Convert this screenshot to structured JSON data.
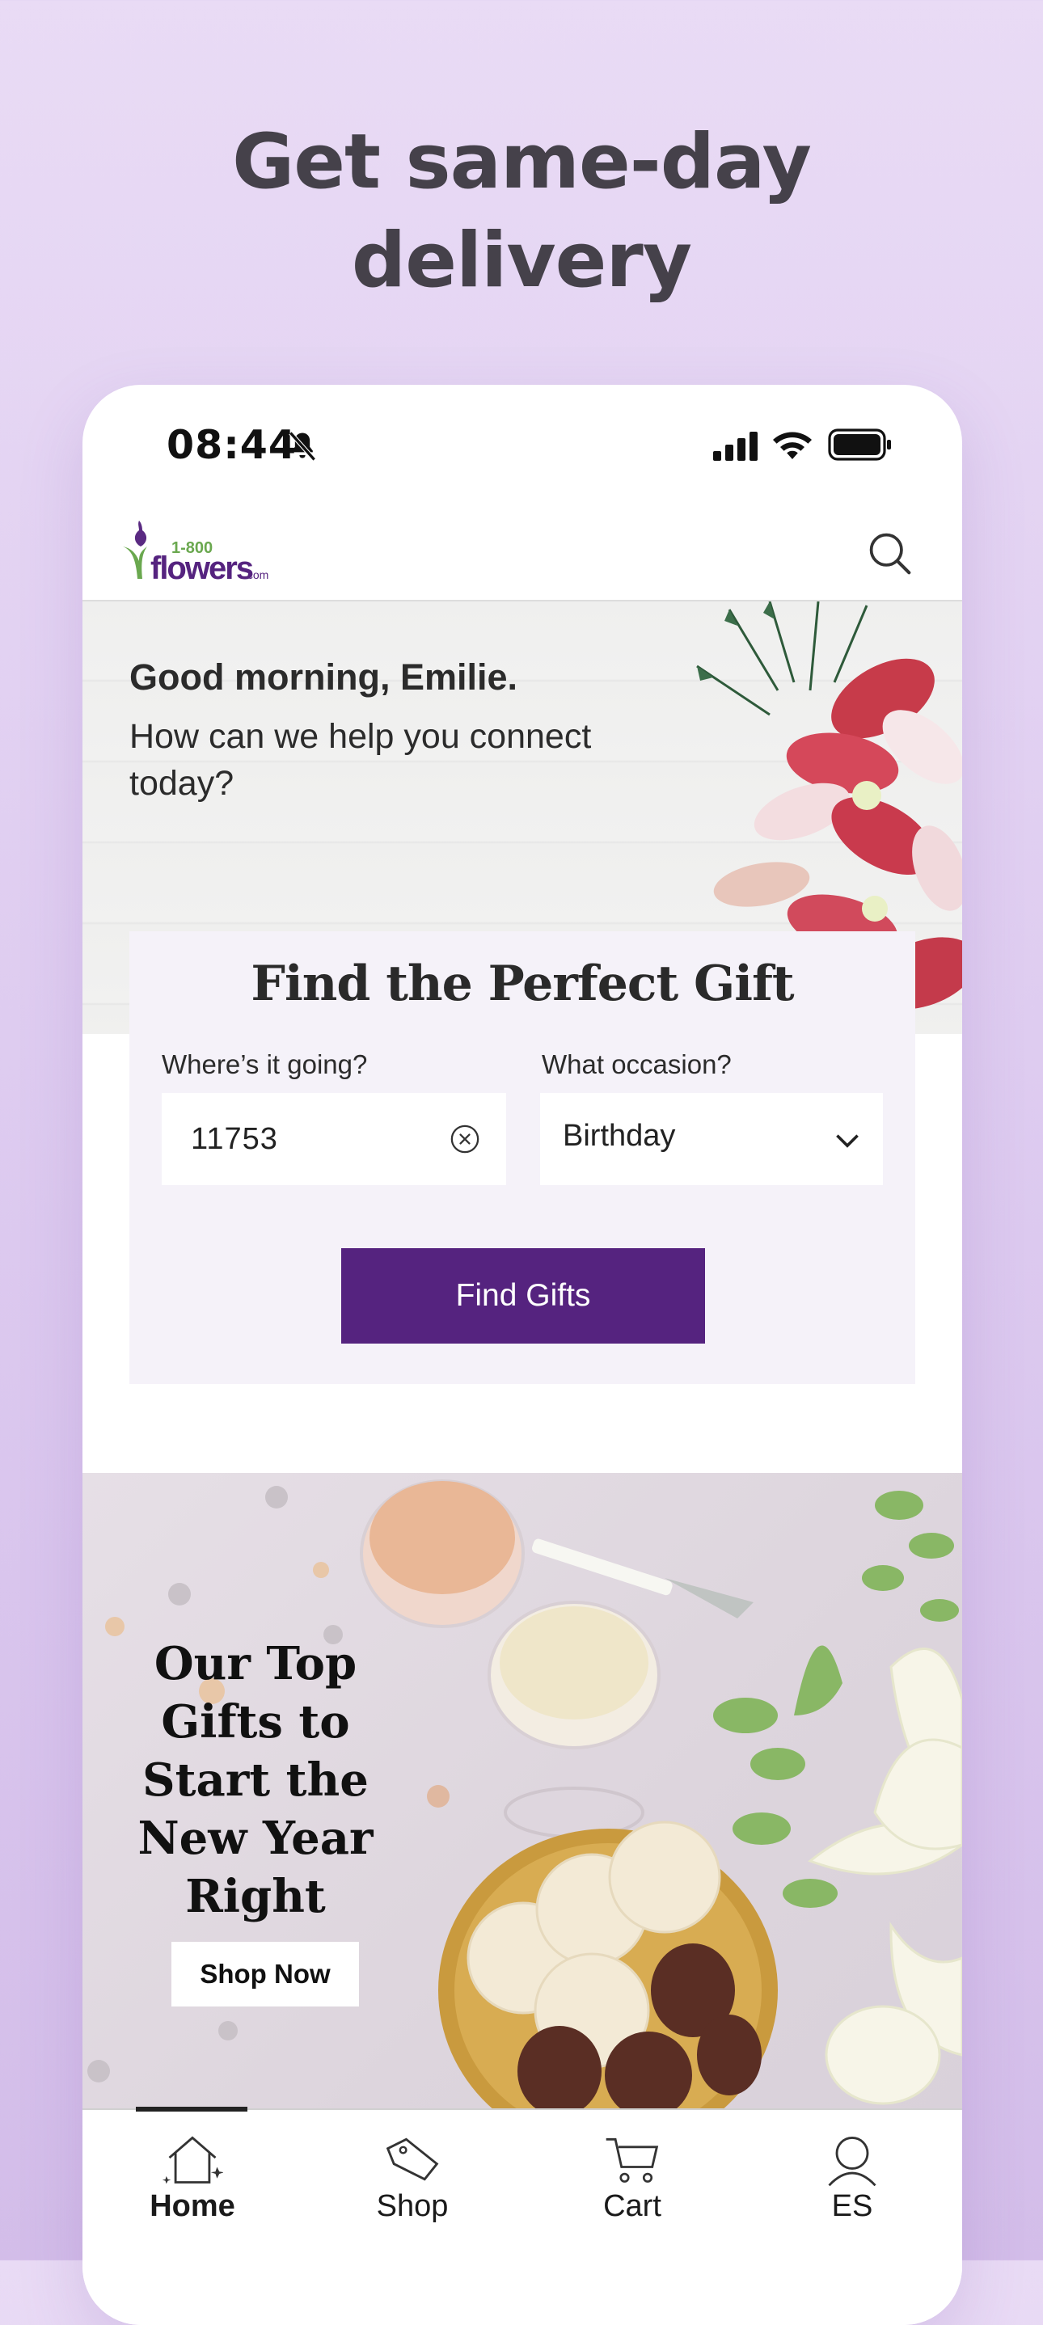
{
  "promo_headline": [
    "Get same-day",
    "delivery"
  ],
  "status_bar": {
    "time": "08:44"
  },
  "header": {
    "logo_name": "1-800 flowers.com",
    "search_icon": "search-icon"
  },
  "hero": {
    "greeting": "Good morning, Emilie.",
    "subtitle": "How can we help you connect today?"
  },
  "gift_finder": {
    "title": "Find the Perfect Gift",
    "zip_label": "Where’s it going?",
    "zip_value": "11753",
    "occasion_label": "What occasion?",
    "occasion_value": "Birthday",
    "button_label": "Find Gifts"
  },
  "promo_banner": {
    "title": "Our Top Gifts to Start the New Year Right",
    "button_label": "Shop Now"
  },
  "bottom_nav": {
    "items": [
      {
        "label": "Home",
        "icon": "home-icon",
        "active": true
      },
      {
        "label": "Shop",
        "icon": "tag-icon",
        "active": false
      },
      {
        "label": "Cart",
        "icon": "cart-icon",
        "active": false
      },
      {
        "label": "ES",
        "icon": "person-icon",
        "active": false
      }
    ]
  },
  "colors": {
    "brand_purple": "#55237f",
    "background": "#e9dbf5",
    "logo_green": "#6aa84f"
  }
}
